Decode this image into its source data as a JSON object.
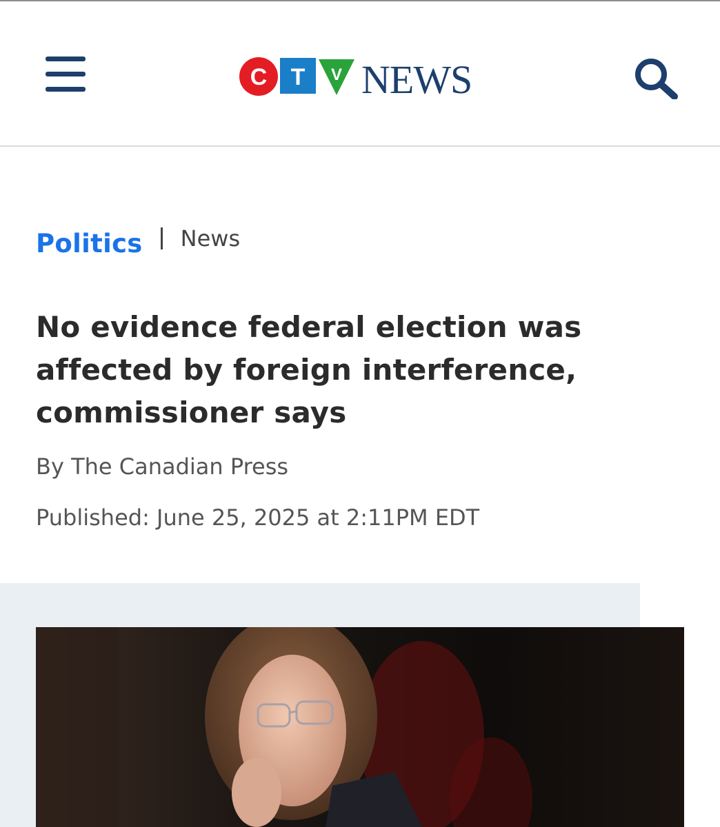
{
  "header": {
    "menu_icon": "hamburger-menu-icon",
    "logo": {
      "text_news": "NEWS",
      "letters": [
        "C",
        "T",
        "V"
      ],
      "colors": {
        "c": "#e41d25",
        "t": "#1a7ec8",
        "v": "#2aa33a",
        "news": "#1c3f6c"
      }
    },
    "search_icon": "search-icon"
  },
  "breadcrumb": {
    "section": "Politics",
    "subsection": "News"
  },
  "article": {
    "headline": "No evidence federal election was affected by foreign interference, commissioner says",
    "byline": "By The Canadian Press",
    "published": "Published: June 25, 2025 at 2:11PM EDT"
  },
  "colors": {
    "link_blue": "#1a73e8",
    "headline_text": "#2b2b2b",
    "meta_text": "#555555",
    "header_icon": "#1c3f6c",
    "media_background": "#eaeff4"
  }
}
